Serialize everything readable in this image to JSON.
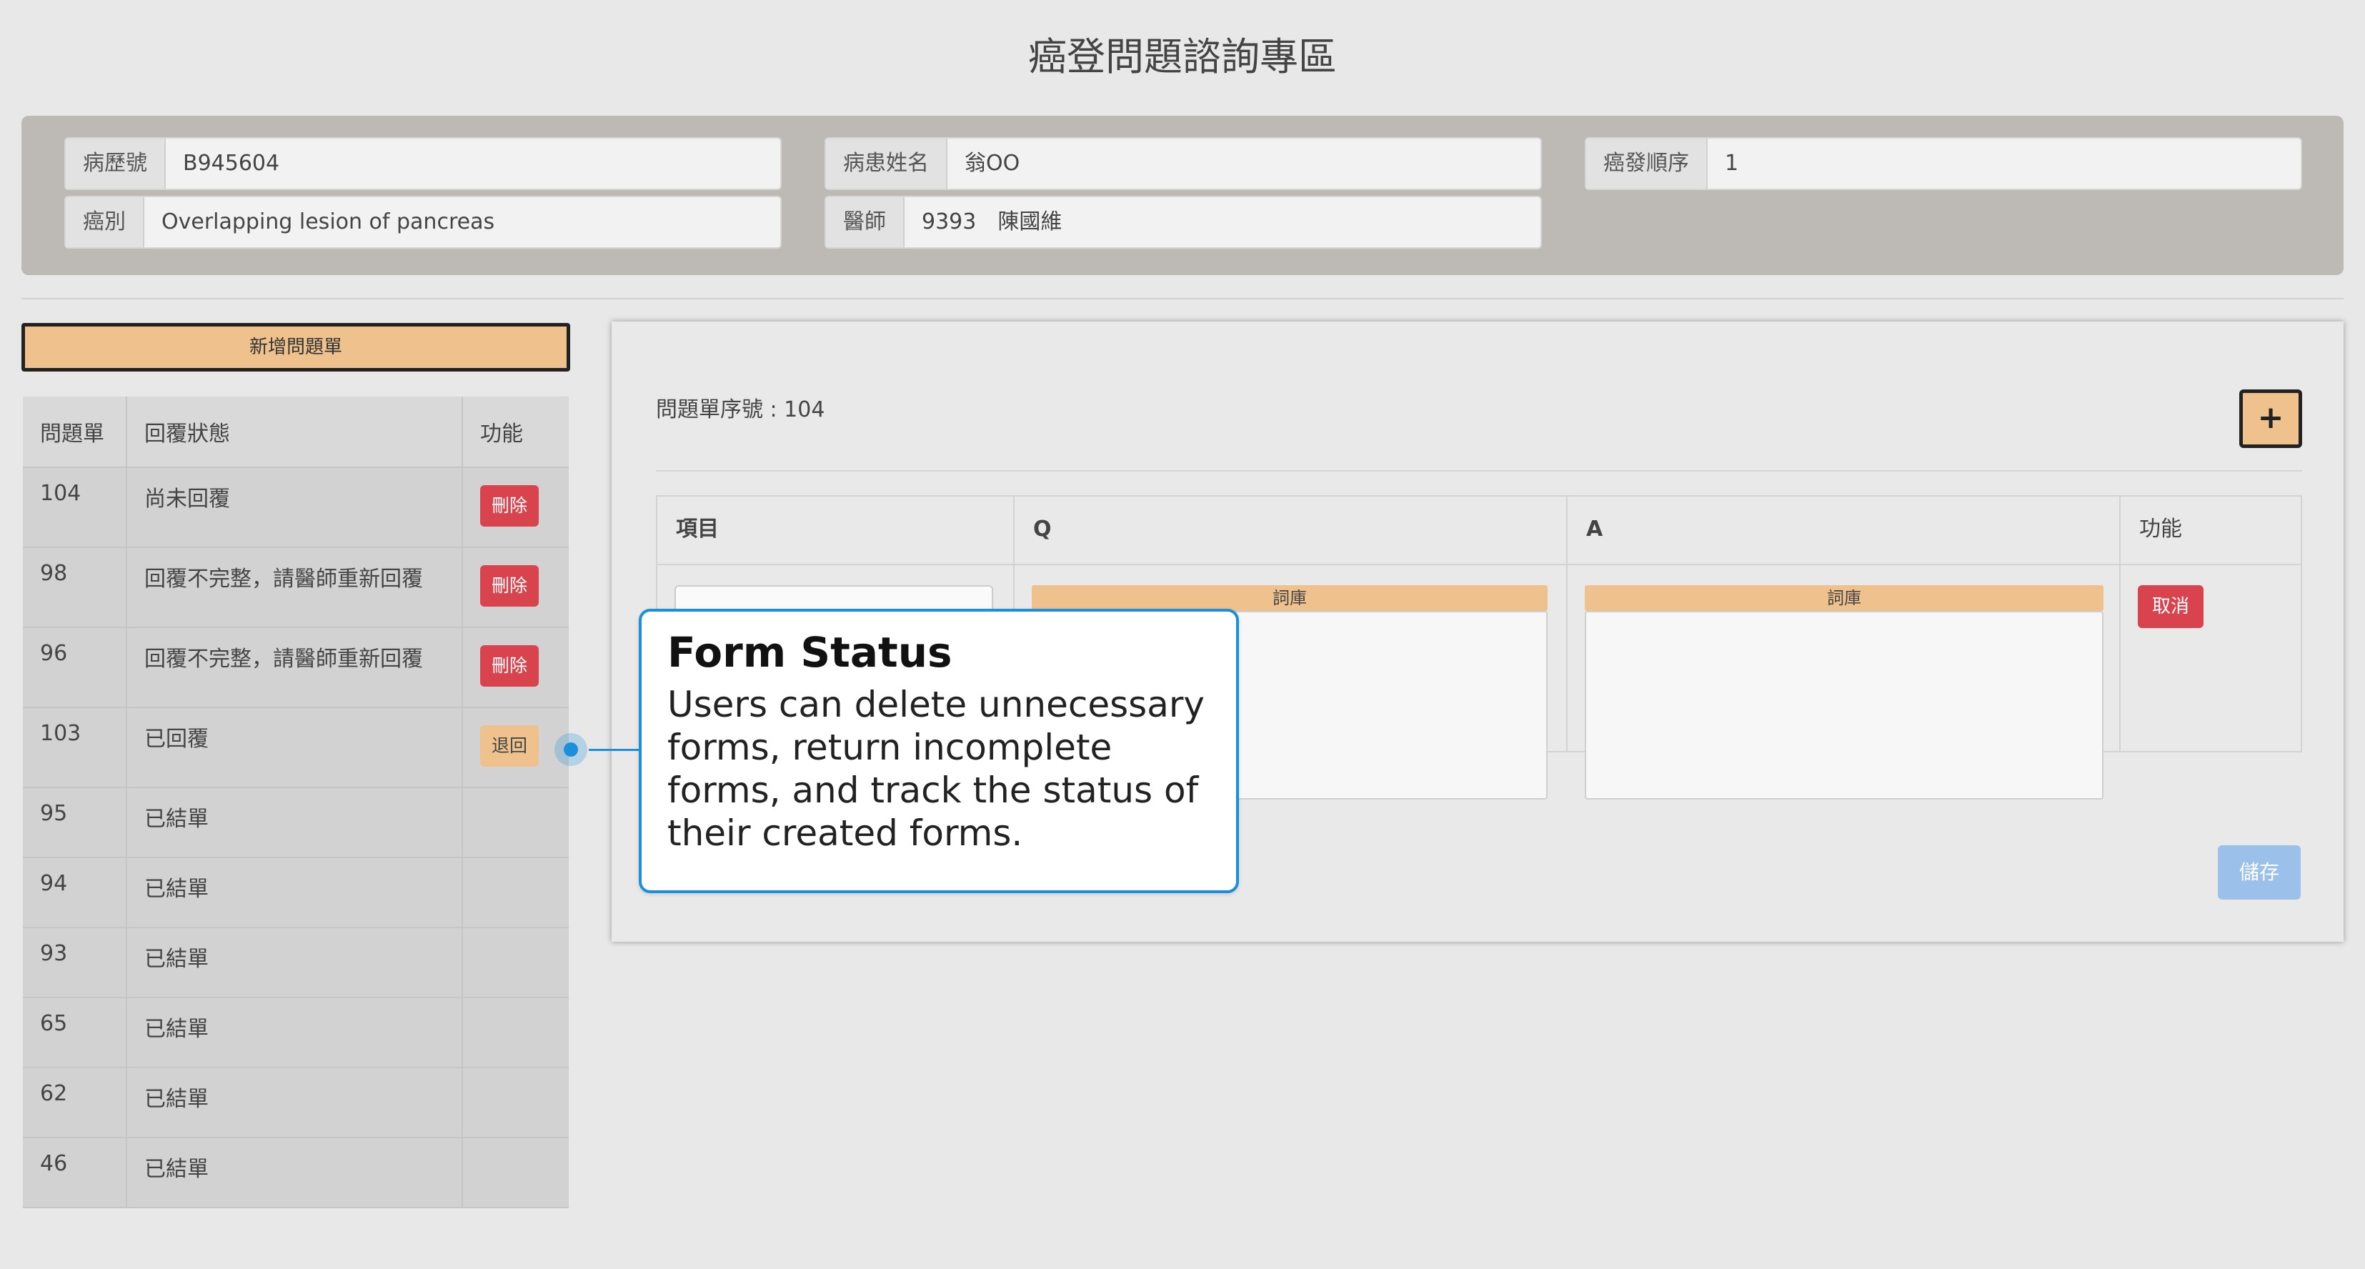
{
  "page_title": "癌登問題諮詢專區",
  "patient": {
    "chart_no_label": "病歷號",
    "chart_no": "B945604",
    "patient_name_label": "病患姓名",
    "patient_name": "翁OO",
    "cancer_order_label": "癌發順序",
    "cancer_order": "1",
    "cancer_type_label": "癌別",
    "cancer_type": "Overlapping lesion of pancreas",
    "doctor_label": "醫師",
    "doctor": "9393　陳國維"
  },
  "form_list": {
    "new_button": "新增問題單",
    "headers": [
      "問題單",
      "回覆狀態",
      "功能"
    ],
    "rows": [
      {
        "id": "104",
        "status": "尚未回覆",
        "action": "刪除",
        "action_type": "delete"
      },
      {
        "id": "98",
        "status": "回覆不完整，請醫師重新回覆",
        "action": "刪除",
        "action_type": "delete"
      },
      {
        "id": "96",
        "status": "回覆不完整，請醫師重新回覆",
        "action": "刪除",
        "action_type": "delete"
      },
      {
        "id": "103",
        "status": "已回覆",
        "action": "退回",
        "action_type": "return"
      },
      {
        "id": "95",
        "status": "已結單",
        "action": "",
        "action_type": "none"
      },
      {
        "id": "94",
        "status": "已結單",
        "action": "",
        "action_type": "none"
      },
      {
        "id": "93",
        "status": "已結單",
        "action": "",
        "action_type": "none"
      },
      {
        "id": "65",
        "status": "已結單",
        "action": "",
        "action_type": "none"
      },
      {
        "id": "62",
        "status": "已結單",
        "action": "",
        "action_type": "none"
      },
      {
        "id": "46",
        "status": "已結單",
        "action": "",
        "action_type": "none"
      }
    ]
  },
  "detail": {
    "serial_label": "問題單序號 : 104",
    "add_button": "+",
    "headers": {
      "item": "項目",
      "q": "Q",
      "a": "A",
      "function": "功能"
    },
    "library_button": "詞庫",
    "cancel_button": "取消",
    "save_button": "儲存"
  },
  "callout": {
    "title": "Form Status",
    "body": "Users can delete unnecessary forms, return incomplete forms, and track the status of their created forms."
  },
  "colors": {
    "accent_orange": "#eec18d",
    "danger_red": "#d9434d",
    "save_blue": "#9bc1ea",
    "callout_blue": "#1c8fdb",
    "info_panel_bg": "#bdb9b5"
  }
}
